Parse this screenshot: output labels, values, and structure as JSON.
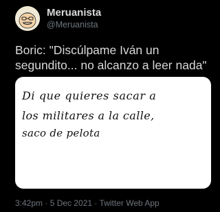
{
  "author": {
    "display_name": "Meruanista",
    "handle": "@Meruanista",
    "avatar_icon": "cartoon-face-avatar"
  },
  "tweet": {
    "text": "Boric: \"Discúlpame Iván un segundito... no alcanzo a leer nada\"",
    "image": {
      "handwritten_lines": [
        "Di que quieres sacar a",
        "los militares  a la calle,",
        "saco de pelota"
      ]
    }
  },
  "meta": {
    "time": "3:42pm",
    "separator_1": " · ",
    "date": "5 Dec 2021",
    "separator_2": " · ",
    "source": "Twitter Web App"
  },
  "colors": {
    "background": "#000000",
    "primary_text": "#d9d9d9",
    "secondary_text": "#6e767d",
    "ink": "#111111"
  }
}
